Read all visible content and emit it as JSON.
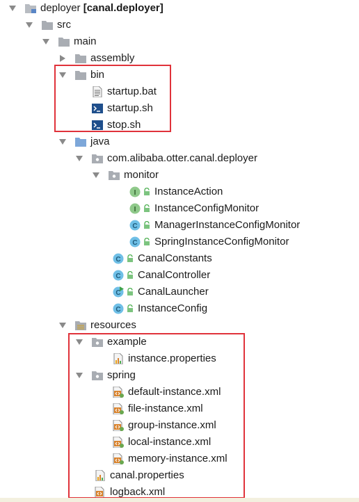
{
  "project": {
    "name": "deployer",
    "module": "[canal.deployer]"
  },
  "src": "src",
  "main": "main",
  "assembly": "assembly",
  "bin": {
    "label": "bin",
    "files": [
      "startup.bat",
      "startup.sh",
      "stop.sh"
    ]
  },
  "java": "java",
  "package": "com.alibaba.otter.canal.deployer",
  "monitor": {
    "label": "monitor",
    "items": [
      "InstanceAction",
      "InstanceConfigMonitor",
      "ManagerInstanceConfigMonitor",
      "SpringInstanceConfigMonitor"
    ]
  },
  "classes": [
    "CanalConstants",
    "CanalController",
    "CanalLauncher",
    "InstanceConfig"
  ],
  "resources": "resources",
  "example": {
    "label": "example",
    "file": "instance.properties"
  },
  "spring": {
    "label": "spring",
    "files": [
      "default-instance.xml",
      "file-instance.xml",
      "group-instance.xml",
      "local-instance.xml",
      "memory-instance.xml"
    ]
  },
  "canal_properties": "canal.properties",
  "logback": "logback.xml",
  "colors": {
    "highlight_border": "#e0323a",
    "interface_icon": "#8fc98a",
    "class_icon": "#6fbfe6"
  }
}
